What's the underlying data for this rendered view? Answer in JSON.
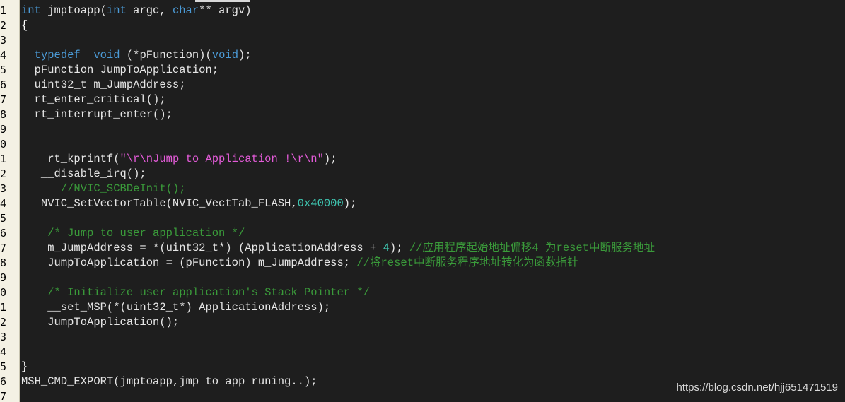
{
  "line_numbers": [
    "1",
    "2",
    "3",
    "4",
    "5",
    "6",
    "7",
    "8",
    "9",
    "0",
    "1",
    "2",
    "3",
    "4",
    "5",
    "6",
    "7",
    "8",
    "9",
    "0",
    "1",
    "2",
    "3",
    "4",
    "5",
    "6",
    "7"
  ],
  "code": {
    "l1": {
      "t1": "int",
      "t2": " jmptoapp(",
      "t3": "int",
      "t4": " argc, ",
      "t5": "char",
      "t6": "** argv)"
    },
    "l2": {
      "t1": "{"
    },
    "l4": {
      "t1": "  ",
      "t2": "typedef",
      "t3": "  ",
      "t4": "void",
      "t5": " (*pFunction)(",
      "t6": "void",
      "t7": ");"
    },
    "l5": {
      "t1": "  pFunction JumpToApplication;"
    },
    "l6": {
      "t1": "  uint32_t m_JumpAddress;"
    },
    "l7": {
      "t1": "  rt_enter_critical();"
    },
    "l8": {
      "t1": "  rt_interrupt_enter();"
    },
    "l11": {
      "t1": "    rt_kprintf(",
      "t2": "\"\\r\\nJump to Application !\\r\\n\"",
      "t3": ");"
    },
    "l12": {
      "t1": "   __disable_irq();"
    },
    "l13": {
      "t1": "      ",
      "t2": "//NVIC_SCBDeInit();"
    },
    "l14": {
      "t1": "   NVIC_SetVectorTable(NVIC_VectTab_FLASH,",
      "t2": "0x40000",
      "t3": ");"
    },
    "l16": {
      "t1": "    ",
      "t2": "/* Jump to user application */"
    },
    "l17": {
      "t1": "    m_JumpAddress = *(uint32_t*) (ApplicationAddress + ",
      "t2": "4",
      "t3": "); ",
      "t4": "//应用程序起始地址偏移4 为reset中断服务地址"
    },
    "l18": {
      "t1": "    JumpToApplication = (pFunction) m_JumpAddress; ",
      "t2": "//将reset中断服务程序地址转化为函数指针"
    },
    "l20": {
      "t1": "    ",
      "t2": "/* Initialize user application's Stack Pointer */"
    },
    "l21": {
      "t1": "    __set_MSP(*(uint32_t*) ApplicationAddress);"
    },
    "l22": {
      "t1": "    JumpToApplication();"
    },
    "l25": {
      "t1": "}"
    },
    "l26": {
      "t1": "MSH_CMD_EXPORT(jmptoapp,jmp to app runing..);"
    }
  },
  "watermark": "https://blog.csdn.net/hjj651471519",
  "colors": {
    "background": "#1e1e1e",
    "gutter": "#f4f1e4",
    "keyword": "#4b9ad6",
    "string": "#e35bd8",
    "number": "#3fc7b2",
    "comment": "#3a9a3a",
    "text": "#e6e6e6"
  }
}
